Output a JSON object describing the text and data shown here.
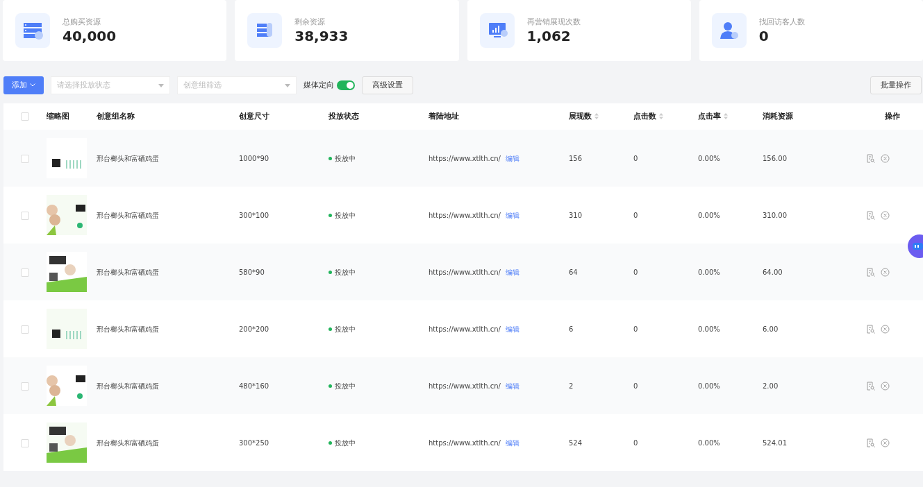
{
  "stats": [
    {
      "label": "总购买资源",
      "value": "40,000"
    },
    {
      "label": "剩余资源",
      "value": "38,933"
    },
    {
      "label": "再营销展现次数",
      "value": "1,062"
    },
    {
      "label": "找回访客人数",
      "value": "0"
    }
  ],
  "toolbar": {
    "add_button": "添加",
    "status_select": {
      "placeholder": "请选择投放状态"
    },
    "group_select": {
      "placeholder": "创意组筛选"
    },
    "media_toggle": {
      "label": "媒体定向",
      "on": true
    },
    "advanced_button": "高级设置",
    "batch_button": "批量操作"
  },
  "table": {
    "header_checked": false,
    "columns": [
      {
        "label": "缩略图",
        "sortable": false
      },
      {
        "label": "创意组名称",
        "sortable": false
      },
      {
        "label": "创意尺寸",
        "sortable": false
      },
      {
        "label": "投放状态",
        "sortable": false
      },
      {
        "label": "着陆地址",
        "sortable": false
      },
      {
        "label": "展现数",
        "sortable": true
      },
      {
        "label": "点击数",
        "sortable": true
      },
      {
        "label": "点击率",
        "sortable": true
      },
      {
        "label": "消耗资源",
        "sortable": false
      },
      {
        "label": "操作",
        "sortable": false
      }
    ],
    "rows": [
      {
        "checked": false,
        "name": "邢台榔头和富硒鸡蛋",
        "size": "1000*90",
        "status": "投放中",
        "url": "https://www.xtlth.cn/",
        "edit": "编辑",
        "views": "156",
        "clicks": "0",
        "ctr": "0.00%",
        "cost": "156.00"
      },
      {
        "checked": false,
        "name": "邢台榔头和富硒鸡蛋",
        "size": "300*100",
        "status": "投放中",
        "url": "https://www.xtlth.cn/",
        "edit": "编辑",
        "views": "310",
        "clicks": "0",
        "ctr": "0.00%",
        "cost": "310.00"
      },
      {
        "checked": false,
        "name": "邢台榔头和富硒鸡蛋",
        "size": "580*90",
        "status": "投放中",
        "url": "https://www.xtlth.cn/",
        "edit": "编辑",
        "views": "64",
        "clicks": "0",
        "ctr": "0.00%",
        "cost": "64.00"
      },
      {
        "checked": false,
        "name": "邢台榔头和富硒鸡蛋",
        "size": "200*200",
        "status": "投放中",
        "url": "https://www.xtlth.cn/",
        "edit": "编辑",
        "views": "6",
        "clicks": "0",
        "ctr": "0.00%",
        "cost": "6.00"
      },
      {
        "checked": false,
        "name": "邢台榔头和富硒鸡蛋",
        "size": "480*160",
        "status": "投放中",
        "url": "https://www.xtlth.cn/",
        "edit": "编辑",
        "views": "2",
        "clicks": "0",
        "ctr": "0.00%",
        "cost": "2.00"
      },
      {
        "checked": false,
        "name": "邢台榔头和富硒鸡蛋",
        "size": "300*250",
        "status": "投放中",
        "url": "https://www.xtlth.cn/",
        "edit": "编辑",
        "views": "524",
        "clicks": "0",
        "ctr": "0.00%",
        "cost": "524.01"
      }
    ]
  }
}
